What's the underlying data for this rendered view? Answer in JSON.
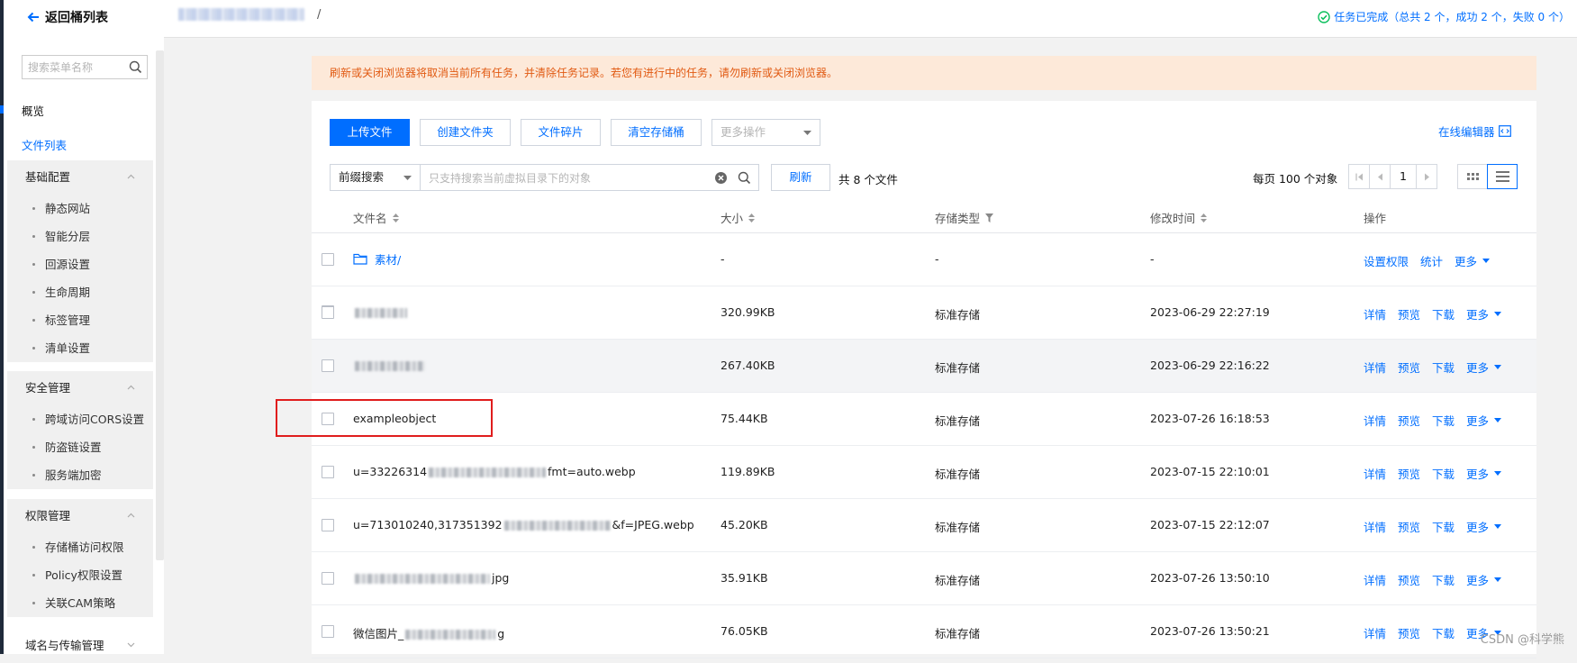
{
  "sidebar": {
    "back_label": "返回桶列表",
    "search_placeholder": "搜索菜单名称",
    "overview": "概览",
    "file_list": "文件列表",
    "groups": [
      {
        "title": "基础配置",
        "items": [
          "静态网站",
          "智能分层",
          "回源设置",
          "生命周期",
          "标签管理",
          "清单设置"
        ]
      },
      {
        "title": "安全管理",
        "items": [
          "跨域访问CORS设置",
          "防盗链设置",
          "服务端加密"
        ]
      },
      {
        "title": "权限管理",
        "items": [
          "存储桶访问权限",
          "Policy权限设置",
          "关联CAM策略"
        ]
      },
      {
        "title": "域名与传输管理",
        "items": []
      }
    ]
  },
  "header": {
    "breadcrumb_sep": "/",
    "task_status": "任务已完成",
    "task_summary": "（总共 2 个，成功 2 个，失败 0 个）"
  },
  "alert_text": "刷新或关闭浏览器将取消当前所有任务，并清除任务记录。若您有进行中的任务，请勿刷新或关闭浏览器。",
  "toolbar": {
    "upload": "上传文件",
    "create_folder": "创建文件夹",
    "fragments": "文件碎片",
    "clear_bucket": "清空存储桶",
    "more_actions": "更多操作",
    "online_editor": "在线编辑器"
  },
  "filter": {
    "search_mode": "前缀搜索",
    "placeholder": "只支持搜索当前虚拟目录下的对象",
    "refresh": "刷新",
    "count": "共 8 个文件",
    "per_page": "每页 100 个对象",
    "page": "1"
  },
  "table": {
    "headers": {
      "name": "文件名",
      "size": "大小",
      "storage": "存储类型",
      "mtime": "修改时间",
      "ops": "操作"
    },
    "folder_ops": [
      "设置权限",
      "统计",
      "更多"
    ],
    "file_ops": [
      "详情",
      "预览",
      "下载",
      "更多"
    ],
    "rows": [
      {
        "name_pre": "素材/",
        "name_post": "",
        "size": "-",
        "storage": "-",
        "mtime": "-",
        "folder": true
      },
      {
        "name_pre": "",
        "name_post": "",
        "size": "320.99KB",
        "storage": "标准存储",
        "mtime": "2023-06-29 22:27:19"
      },
      {
        "name_pre": "",
        "name_post": "",
        "size": "267.40KB",
        "storage": "标准存储",
        "mtime": "2023-06-29 22:16:22"
      },
      {
        "name_pre": "exampleobject",
        "name_post": "",
        "size": "75.44KB",
        "storage": "标准存储",
        "mtime": "2023-07-26 16:18:53"
      },
      {
        "name_pre": "u=33226314",
        "name_post": "fmt=auto.webp",
        "size": "119.89KB",
        "storage": "标准存储",
        "mtime": "2023-07-15 22:10:01"
      },
      {
        "name_pre": "u=713010240,317351392",
        "name_post": "&f=JPEG.webp",
        "size": "45.20KB",
        "storage": "标准存储",
        "mtime": "2023-07-15 22:12:07"
      },
      {
        "name_pre": "",
        "name_post": "jpg",
        "size": "35.91KB",
        "storage": "标准存储",
        "mtime": "2023-07-26 13:50:10"
      },
      {
        "name_pre": "微信图片_",
        "name_post": "g",
        "size": "76.05KB",
        "storage": "标准存储",
        "mtime": "2023-07-26 13:50:21"
      }
    ]
  },
  "watermark": "CSDN @科学熊",
  "colors": {
    "accent": "#006eff",
    "alert_bg": "#fde9d9",
    "alert_text": "#e15a12",
    "highlight": "#e01d1d"
  }
}
